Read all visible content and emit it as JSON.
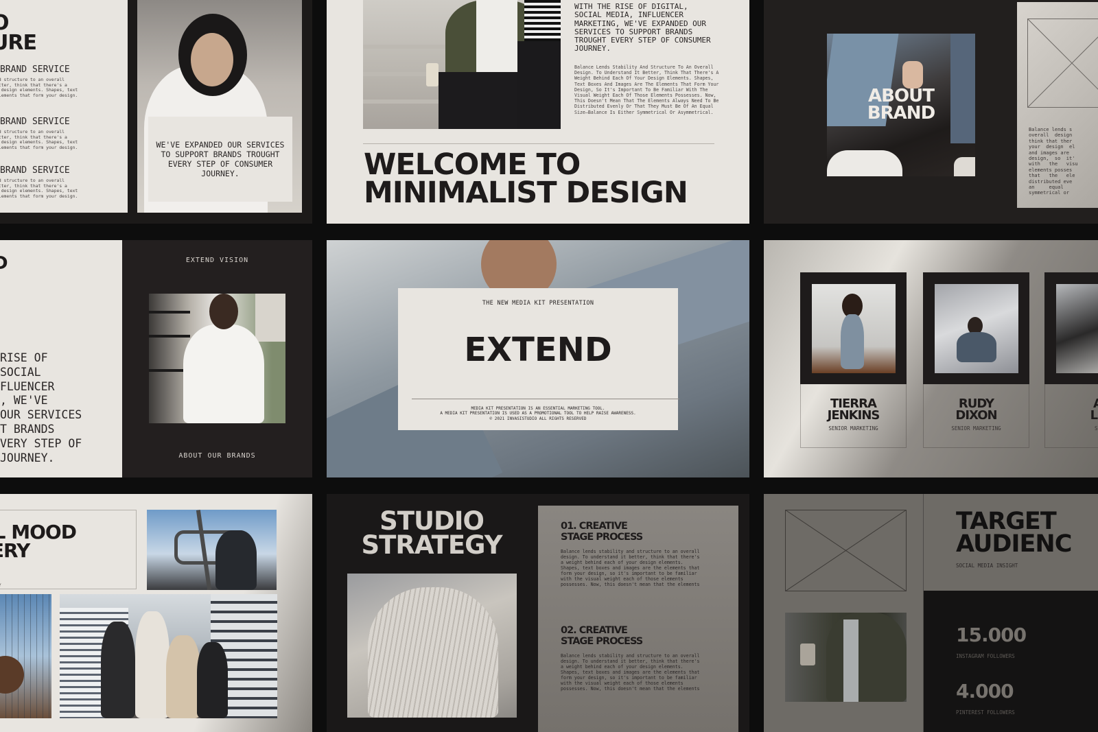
{
  "slides": {
    "service": {
      "title_partial": "O\nURE",
      "services": [
        {
          "title": "BRAND SERVICE",
          "body": "nd structure to an overall\netter, think that there's a\nr design elements. Shapes, text\nelements that form your design."
        },
        {
          "title": "BRAND SERVICE",
          "body": "nd structure to an overall\netter, think that there's a\nr design elements. Shapes, text\nelements that form your design."
        },
        {
          "title": "BRAND SERVICE",
          "body": "nd structure to an overall\netter, think that there's a\nr design elements. Shapes, text\nelements that form your design."
        }
      ],
      "quote": "WE'VE EXPANDED OUR SERVICES TO SUPPORT BRANDS TROUGHT EVERY STEP OF CONSUMER JOURNEY."
    },
    "welcome": {
      "intro": "WITH THE RISE OF DIGITAL, SOCIAL MEDIA, INFLUENCER MARKETING, WE'VE EXPANDED OUR SERVICES TO SUPPORT BRANDS TROUGHT EVERY STEP OF CONSUMER JOURNEY.",
      "body": "Balance Lends Stability And Structure To An Overall Design. To Understand It Better, Think That There's A Weight Behind Each Of Your Design Elements. Shapes, Text Boxes And Images Are The Elements That Form Your Design, So It's Important To Be Familiar With The Visual Weight Each Of Those Elements Possesses. Now, This Doesn't Mean That The Elements Always Need To Be Distributed Evenly Or That They Must Be Of An Equal Size—Balance Is Either Symmetrical Or Asymmetrical.",
      "headline_line1": "WELCOME TO",
      "headline_line2": "MINIMALIST DESIGN"
    },
    "about_brand": {
      "title": "ABOUT\nBRAND",
      "side_text": "Balance lends s\noverall  design\nthink that ther\nyour  design  el\nand images are \ndesign,  so  it'\nwith   the   visu\nelements posses\nthat   the   ele\ndistributed eve\nan     equal     \nsymmetrical or "
    },
    "vision": {
      "title_partial": "D\n",
      "paragraph": "RISE OF\nSOCIAL\nFLUENCER\n, WE'VE\nOUR SERVICES\nT BRANDS\nVERY STEP OF\nJOURNEY.",
      "label_top": "EXTEND VISION",
      "label_bottom": "ABOUT OUR BRANDS"
    },
    "cover": {
      "kicker": "THE NEW MEDIA KIT PRESENTATION",
      "brand": "EXTEND",
      "fine_print_1": "MEDIA KIT PRESENTATION IS AN ESSENTIAL MARKETING TOOL.",
      "fine_print_2": "A MEDIA KIT PRESENTATION IS USED AS A PROMOTIONAL TOOL TO HELP RAISE AWARENESS.",
      "fine_print_3": "© 2021 INVASISTUDIO ALL RIGHTS RESERVED"
    },
    "team": {
      "members": [
        {
          "name": "TIERRA\nJENKINS",
          "role": "SENIOR MARKETING"
        },
        {
          "name": "RUDY\nDIXON",
          "role": "SENIOR MARKETING"
        },
        {
          "name": "A\nLE",
          "role": "SE"
        }
      ]
    },
    "mood": {
      "title_partial": "AL MOOD\nLERY",
      "sub_partial": "Y"
    },
    "strategy": {
      "title_line1": "STUDIO",
      "title_line2": "STRATEGY",
      "steps": [
        {
          "title": "01. CREATIVE\nSTAGE PROCESS",
          "body": "Balance lends stability and structure to an overall design. To understand it better, think that there's a weight behind each of your design elements. Shapes, text boxes and images are the elements that form your design, so it's important to be familiar with the visual weight each of those elements possesses. Now, this doesn't mean that the elements"
        },
        {
          "title": "02. CREATIVE\nSTAGE PROCESS",
          "body": "Balance lends stability and structure to an overall design. To understand it better, think that there's a weight behind each of your design elements. Shapes, text boxes and images are the elements that form your design, so it's important to be familiar with the visual weight each of those elements possesses. Now, this doesn't mean that the elements"
        }
      ]
    },
    "audience": {
      "title": "TARGET\nAUDIENC",
      "subtitle": "SOCIAL MEDIA INSIGHT",
      "stats": [
        {
          "value": "15.000",
          "label": "INSTAGRAM FOLLOWERS"
        },
        {
          "value": "4.000",
          "label": "PINTEREST FOLLOWERS"
        }
      ]
    }
  },
  "colors": {
    "paper": "#e8e5e0",
    "ink": "#1e1b1b",
    "dark_slide": "#231f1f",
    "background": "#0d0d0d",
    "taupe": "#6e6b66"
  }
}
